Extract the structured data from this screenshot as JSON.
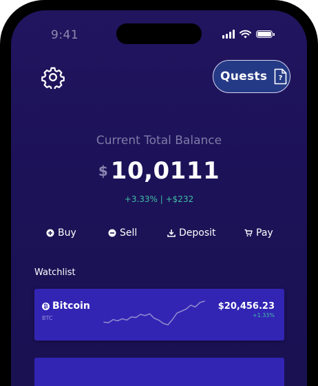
{
  "status_bar": {
    "time": "9:41"
  },
  "header": {
    "quests_label": "Quests"
  },
  "balance": {
    "label": "Current Total Balance",
    "currency": "$",
    "amount": "10,0111",
    "change": "+3.33% | +$232"
  },
  "actions": [
    {
      "label": "Buy",
      "icon": "plus-circle-icon"
    },
    {
      "label": "Sell",
      "icon": "minus-circle-icon"
    },
    {
      "label": "Deposit",
      "icon": "download-icon"
    },
    {
      "label": "Pay",
      "icon": "cart-icon"
    }
  ],
  "watchlist": {
    "title": "Watchlist",
    "items": [
      {
        "name": "Bitcoin",
        "symbol": "BTC",
        "icon_letter": "₿",
        "price": "$20,456.23",
        "change": "+1.33%",
        "sparkline": [
          0.2,
          0.18,
          0.3,
          0.25,
          0.33,
          0.28,
          0.4,
          0.38,
          0.5,
          0.45,
          0.52,
          0.35,
          0.28,
          0.15,
          0.1,
          0.3,
          0.55,
          0.62,
          0.7,
          0.85,
          0.78,
          0.95,
          1.0
        ]
      }
    ]
  },
  "colors": {
    "background": "#1c1258",
    "card": "#3225b4",
    "positive": "#3fbfa3",
    "quests_button": "#253a86"
  }
}
